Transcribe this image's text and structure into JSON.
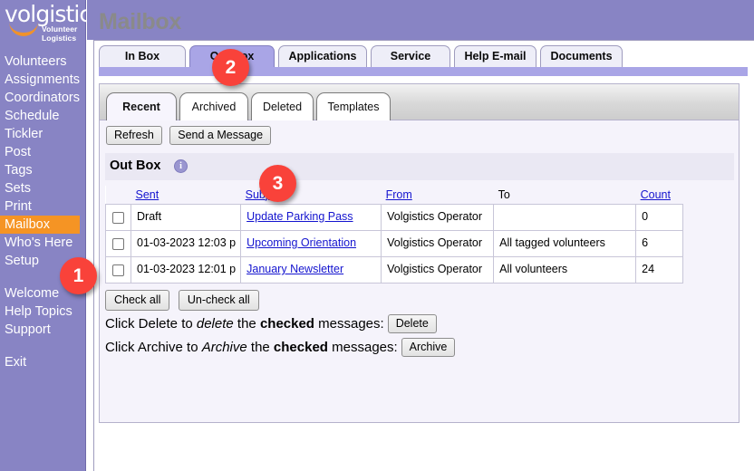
{
  "logo": {
    "word": "volgistics",
    "tm": "™",
    "tagline": "Volunteer Logistics"
  },
  "sidebar": {
    "items": [
      {
        "label": "Volunteers",
        "active": false
      },
      {
        "label": "Assignments",
        "active": false
      },
      {
        "label": "Coordinators",
        "active": false
      },
      {
        "label": "Schedule",
        "active": false
      },
      {
        "label": "Tickler",
        "active": false
      },
      {
        "label": "Post",
        "active": false
      },
      {
        "label": "Tags",
        "active": false
      },
      {
        "label": "Sets",
        "active": false
      },
      {
        "label": "Print",
        "active": false
      },
      {
        "label": "Mailbox",
        "active": true
      },
      {
        "label": "Who's Here",
        "active": false
      },
      {
        "label": "Setup",
        "active": false
      },
      {
        "label": "Welcome",
        "active": false
      },
      {
        "label": "Help Topics",
        "active": false
      },
      {
        "label": "Support",
        "active": false
      },
      {
        "label": "Exit",
        "active": false
      }
    ]
  },
  "header": {
    "title": "Mailbox"
  },
  "main_tabs": [
    {
      "label": "In Box",
      "active": false
    },
    {
      "label": "Out Box",
      "active": true
    },
    {
      "label": "Applications",
      "active": false
    },
    {
      "label": "Service",
      "active": false
    },
    {
      "label": "Help E-mail",
      "active": false
    },
    {
      "label": "Documents",
      "active": false
    }
  ],
  "sub_tabs": [
    {
      "label": "Recent",
      "active": true
    },
    {
      "label": "Archived",
      "active": false
    },
    {
      "label": "Deleted",
      "active": false
    },
    {
      "label": "Templates",
      "active": false
    }
  ],
  "toolbar": {
    "refresh_label": "Refresh",
    "send_message_label": "Send a Message"
  },
  "outbox": {
    "section_title": "Out Box",
    "info_icon": "info-icon",
    "info_glyph": "i"
  },
  "table": {
    "columns": [
      {
        "label": "Sent",
        "link": true
      },
      {
        "label": "Subject",
        "link": true
      },
      {
        "label": "From",
        "link": true
      },
      {
        "label": "To",
        "link": false
      },
      {
        "label": "Count",
        "link": true
      }
    ],
    "rows": [
      {
        "checked": false,
        "sent": "Draft",
        "subject": "Update Parking Pass",
        "from": "Volgistics Operator",
        "to": "",
        "count": "0"
      },
      {
        "checked": false,
        "sent": "01-03-2023 12:03 p",
        "subject": "Upcoming Orientation",
        "from": "Volgistics Operator",
        "to": "All tagged volunteers",
        "count": "6"
      },
      {
        "checked": false,
        "sent": "01-03-2023 12:01 p",
        "subject": "January Newsletter",
        "from": "Volgistics Operator",
        "to": "All volunteers",
        "count": "24"
      }
    ]
  },
  "footer": {
    "check_all_label": "Check all",
    "uncheck_all_label": "Un-check all",
    "delete_line": {
      "prefix": "Click Delete to ",
      "italic": "delete",
      "middle": " the ",
      "bold": "checked",
      "suffix": " messages:",
      "button": "Delete"
    },
    "archive_line": {
      "prefix": "Click Archive to ",
      "italic": "Archive",
      "middle": " the ",
      "bold": "checked",
      "suffix": " messages:",
      "button": "Archive"
    }
  },
  "callouts": [
    {
      "number": "1",
      "target": "sidebar-item-mailbox"
    },
    {
      "number": "2",
      "target": "main-tab-out-box"
    },
    {
      "number": "3",
      "target": "send-a-message-button"
    }
  ],
  "colors": {
    "brand_purple": "#8884c4",
    "accent_orange": "#f59424",
    "callout_red": "#f9423a",
    "active_tab_purple": "#a9a5e6",
    "link_blue": "#1414cf"
  }
}
